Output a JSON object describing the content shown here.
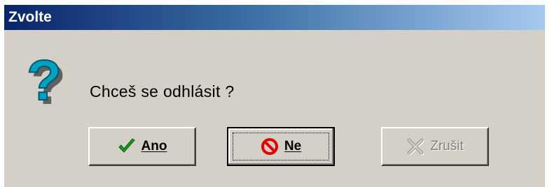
{
  "window": {
    "title": "Zvolte"
  },
  "dialog": {
    "icon": "question-mark-icon",
    "message": "Chceš se odhlásit ?"
  },
  "buttons": {
    "yes": {
      "label": "Ano",
      "icon": "checkmark-icon",
      "color": "#1a9a1a",
      "enabled": true
    },
    "no": {
      "label": "Ne",
      "icon": "no-entry-icon",
      "color": "#e00000",
      "enabled": true,
      "focused": true
    },
    "cancel": {
      "label": "Zrušit",
      "icon": "x-icon",
      "enabled": false
    }
  },
  "colors": {
    "titlebar_start": "#0a246a",
    "titlebar_end": "#a6caf0",
    "face": "#d4d0c8",
    "question_icon": "#00a0c0"
  }
}
